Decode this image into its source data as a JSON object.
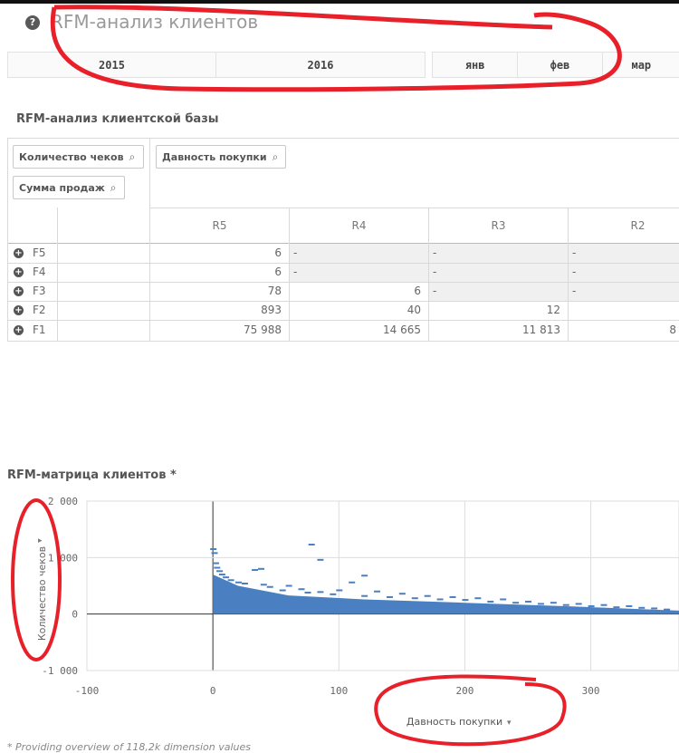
{
  "header": {
    "title": "RFM-анализ клиентов",
    "help_icon": "question-circle-icon"
  },
  "filters": {
    "years": [
      "2015",
      "2016"
    ],
    "months": [
      "янв",
      "фев",
      "мар"
    ]
  },
  "pivot": {
    "title": "RFM-анализ клиентской базы",
    "dimensions": [
      "Количество чеков",
      "Сумма продаж",
      "Давность покупки"
    ],
    "columns": [
      "R5",
      "R4",
      "R3",
      "R2"
    ],
    "rows": [
      {
        "label": "F5",
        "values": [
          "6",
          "-",
          "-",
          "-"
        ]
      },
      {
        "label": "F4",
        "values": [
          "6",
          "-",
          "-",
          "-"
        ]
      },
      {
        "label": "F3",
        "values": [
          "78",
          "6",
          "-",
          "-"
        ]
      },
      {
        "label": "F2",
        "values": [
          "893",
          "40",
          "12",
          ""
        ]
      },
      {
        "label": "F1",
        "values": [
          "75 988",
          "14 665",
          "11 813",
          "8"
        ]
      }
    ]
  },
  "matrix": {
    "title": "RFM-матрица клиентов *",
    "ylabel": "Количество чеков",
    "xlabel": "Давность покупки",
    "footnote": "* Providing overview of 118,2k dimension values"
  },
  "chart_data": {
    "type": "scatter",
    "title": "RFM-матрица клиентов *",
    "xlabel": "Давность покупки",
    "ylabel": "Количество чеков",
    "xlim": [
      -100,
      370
    ],
    "ylim": [
      -1000,
      2000
    ],
    "xticks": [
      "-100",
      "0",
      "100",
      "200",
      "300"
    ],
    "yticks": [
      "2 000",
      "1 000",
      "0",
      "-1 000"
    ],
    "grid": true,
    "series": [
      {
        "color": "#4a7fc1",
        "points": [
          [
            0,
            1150
          ],
          [
            1,
            1080
          ],
          [
            2,
            900
          ],
          [
            3,
            820
          ],
          [
            5,
            760
          ],
          [
            7,
            700
          ],
          [
            10,
            650
          ],
          [
            14,
            600
          ],
          [
            20,
            560
          ],
          [
            25,
            540
          ],
          [
            33,
            780
          ],
          [
            40,
            520
          ],
          [
            45,
            480
          ],
          [
            55,
            420
          ],
          [
            60,
            500
          ],
          [
            70,
            440
          ],
          [
            75,
            380
          ],
          [
            85,
            390
          ],
          [
            95,
            350
          ],
          [
            100,
            420
          ],
          [
            110,
            560
          ],
          [
            120,
            320
          ],
          [
            130,
            400
          ],
          [
            140,
            300
          ],
          [
            150,
            360
          ],
          [
            160,
            280
          ],
          [
            170,
            320
          ],
          [
            180,
            260
          ],
          [
            190,
            300
          ],
          [
            200,
            250
          ],
          [
            210,
            280
          ],
          [
            220,
            220
          ],
          [
            230,
            260
          ],
          [
            240,
            200
          ],
          [
            250,
            220
          ],
          [
            260,
            180
          ],
          [
            270,
            200
          ],
          [
            280,
            160
          ],
          [
            290,
            180
          ],
          [
            300,
            140
          ],
          [
            310,
            160
          ],
          [
            320,
            120
          ],
          [
            330,
            140
          ],
          [
            340,
            110
          ],
          [
            350,
            100
          ],
          [
            360,
            80
          ],
          [
            85,
            960
          ],
          [
            78,
            1230
          ],
          [
            38,
            800
          ],
          [
            120,
            680
          ]
        ]
      }
    ]
  },
  "colors": {
    "accent": "#4a7fc1",
    "annotation": "#e8202a"
  }
}
